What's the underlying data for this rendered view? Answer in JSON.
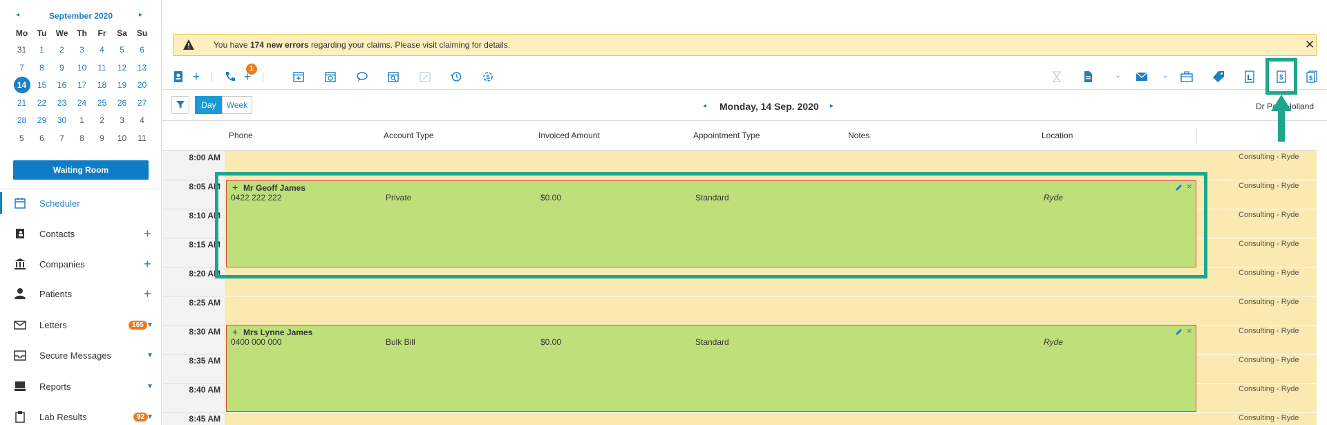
{
  "calendar": {
    "month_label": "September 2020",
    "prev": "◂",
    "next": "▸",
    "weekdays": [
      "Mo",
      "Tu",
      "We",
      "Th",
      "Fr",
      "Sa",
      "Su"
    ],
    "weeks": [
      [
        "31",
        "1",
        "2",
        "3",
        "4",
        "5",
        "6"
      ],
      [
        "7",
        "8",
        "9",
        "10",
        "11",
        "12",
        "13"
      ],
      [
        "14",
        "15",
        "16",
        "17",
        "18",
        "19",
        "20"
      ],
      [
        "21",
        "22",
        "23",
        "24",
        "25",
        "26",
        "27"
      ],
      [
        "28",
        "29",
        "30",
        "1",
        "2",
        "3",
        "4"
      ],
      [
        "5",
        "6",
        "7",
        "8",
        "9",
        "10",
        "11"
      ]
    ],
    "today": "14"
  },
  "sidebar": {
    "waiting_room": "Waiting Room",
    "items": [
      {
        "label": "Scheduler"
      },
      {
        "label": "Contacts"
      },
      {
        "label": "Companies"
      },
      {
        "label": "Patients"
      },
      {
        "label": "Letters",
        "badge": "165"
      },
      {
        "label": "Secure Messages"
      },
      {
        "label": "Reports"
      },
      {
        "label": "Lab Results",
        "badge": "92"
      }
    ]
  },
  "alert": {
    "prefix": "You have ",
    "count": "174 new errors",
    "suffix": " regarding your claims. Please visit claiming for details.",
    "close": "✕"
  },
  "toolbar": {
    "phone_badge": "1"
  },
  "view": {
    "day": "Day",
    "week": "Week",
    "date": "Monday, 14 Sep. 2020",
    "provider": "Dr Paul Holland"
  },
  "columns": [
    "Phone",
    "Account Type",
    "Invoiced Amount",
    "Appointment Type",
    "Notes",
    "Location"
  ],
  "times": [
    "8:00 AM",
    "8:05 AM",
    "8:10 AM",
    "8:15 AM",
    "8:20 AM",
    "8:25 AM",
    "8:30 AM",
    "8:35 AM",
    "8:40 AM",
    "8:45 AM"
  ],
  "slot_location": "Consulting - Ryde",
  "appointments": [
    {
      "name": "Mr Geoff James",
      "phone": "0422 222 222",
      "account": "Private",
      "amount": "$0.00",
      "type": "Standard",
      "location": "Ryde"
    },
    {
      "name": "Mrs Lynne James",
      "phone": "0400 000 000",
      "account": "Bulk Bill",
      "amount": "$0.00",
      "type": "Standard",
      "location": "Ryde"
    }
  ],
  "colors": {
    "accent": "#1a7fc4",
    "highlight": "#1ea58b",
    "appointment": "#bde07b",
    "slot": "#fae9b0"
  }
}
